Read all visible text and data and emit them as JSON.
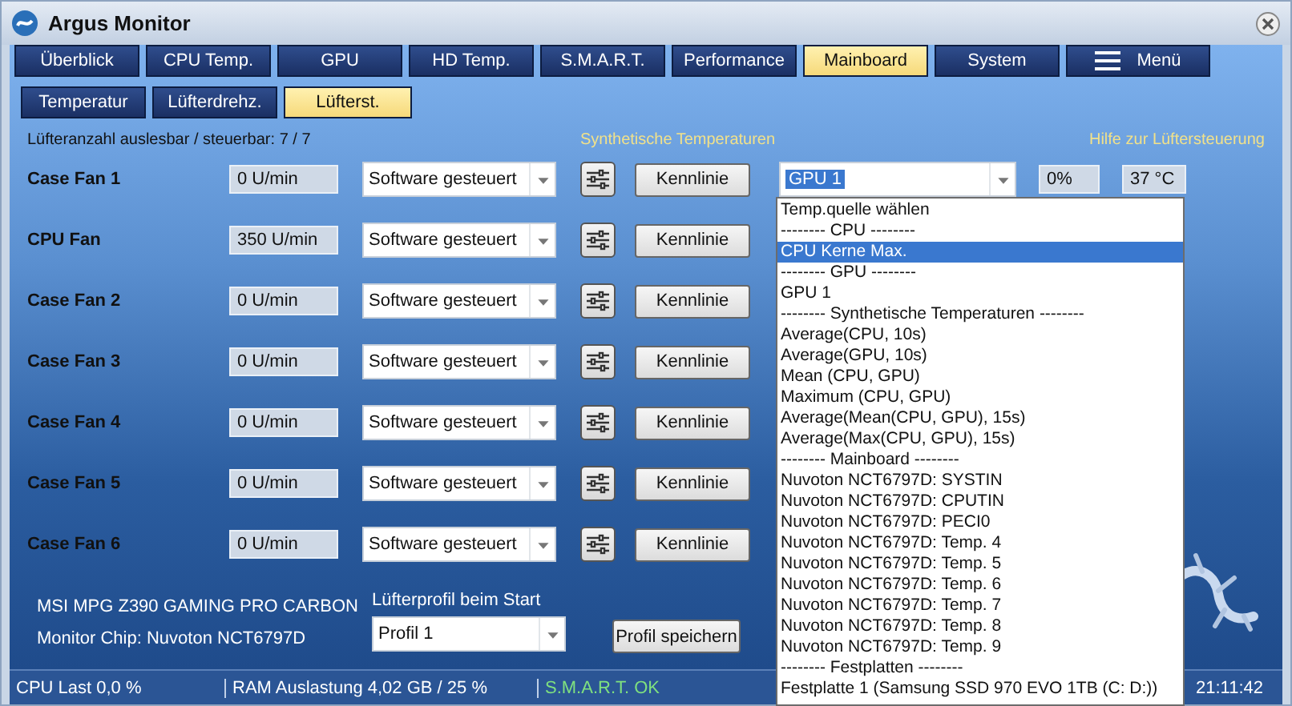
{
  "window": {
    "title": "Argus Monitor"
  },
  "tabs": [
    {
      "label": "Überblick",
      "selected": false,
      "kind": "plain"
    },
    {
      "label": "CPU Temp.",
      "selected": false,
      "kind": "plain"
    },
    {
      "label": "GPU",
      "selected": false,
      "kind": "plain"
    },
    {
      "label": "HD Temp.",
      "selected": false,
      "kind": "plain"
    },
    {
      "label": "S.M.A.R.T.",
      "selected": false,
      "kind": "plain"
    },
    {
      "label": "Performance",
      "selected": false,
      "kind": "plain"
    },
    {
      "label": "Mainboard",
      "selected": true,
      "kind": "plain"
    },
    {
      "label": "System",
      "selected": false,
      "kind": "plain"
    },
    {
      "label": "Menü",
      "selected": false,
      "kind": "menu"
    }
  ],
  "subtabs": [
    {
      "label": "Temperatur",
      "selected": false
    },
    {
      "label": "Lüfterdrehz.",
      "selected": false
    },
    {
      "label": "Lüfterst.",
      "selected": true
    }
  ],
  "info": {
    "fan_count": "Lüfteranzahl auslesbar / steuerbar: 7 / 7",
    "synthetic_link": "Synthetische Temperaturen",
    "help_link": "Hilfe zur Lüftersteuerung"
  },
  "fans": [
    {
      "name": "Case Fan 1",
      "speed": "0 U/min",
      "mode": "Software gesteuert",
      "button": "Kennlinie",
      "source": "GPU 1",
      "percent": "0%",
      "temp": "37 °C"
    },
    {
      "name": "CPU Fan",
      "speed": "350 U/min",
      "mode": "Software gesteuert",
      "button": "Kennlinie"
    },
    {
      "name": "Case Fan 2",
      "speed": "0 U/min",
      "mode": "Software gesteuert",
      "button": "Kennlinie"
    },
    {
      "name": "Case Fan 3",
      "speed": "0 U/min",
      "mode": "Software gesteuert",
      "button": "Kennlinie"
    },
    {
      "name": "Case Fan 4",
      "speed": "0 U/min",
      "mode": "Software gesteuert",
      "button": "Kennlinie"
    },
    {
      "name": "Case Fan 5",
      "speed": "0 U/min",
      "mode": "Software gesteuert",
      "button": "Kennlinie"
    },
    {
      "name": "Case Fan 6",
      "speed": "0 U/min",
      "mode": "Software gesteuert",
      "button": "Kennlinie"
    }
  ],
  "dropdown": [
    {
      "label": "Temp.quelle wählen",
      "selected": false
    },
    {
      "label": "-------- CPU --------",
      "selected": false
    },
    {
      "label": "CPU Kerne Max.",
      "selected": true
    },
    {
      "label": "-------- GPU --------",
      "selected": false
    },
    {
      "label": "GPU 1",
      "selected": false
    },
    {
      "label": "-------- Synthetische Temperaturen --------",
      "selected": false
    },
    {
      "label": "Average(CPU, 10s)",
      "selected": false
    },
    {
      "label": "Average(GPU, 10s)",
      "selected": false
    },
    {
      "label": "Mean (CPU, GPU)",
      "selected": false
    },
    {
      "label": "Maximum (CPU, GPU)",
      "selected": false
    },
    {
      "label": "Average(Mean(CPU, GPU), 15s)",
      "selected": false
    },
    {
      "label": "Average(Max(CPU, GPU), 15s)",
      "selected": false
    },
    {
      "label": "-------- Mainboard --------",
      "selected": false
    },
    {
      "label": "Nuvoton NCT6797D: SYSTIN",
      "selected": false
    },
    {
      "label": "Nuvoton NCT6797D: CPUTIN",
      "selected": false
    },
    {
      "label": "Nuvoton NCT6797D: PECI0",
      "selected": false
    },
    {
      "label": "Nuvoton NCT6797D: Temp. 4",
      "selected": false
    },
    {
      "label": "Nuvoton NCT6797D: Temp. 5",
      "selected": false
    },
    {
      "label": "Nuvoton NCT6797D: Temp. 6",
      "selected": false
    },
    {
      "label": "Nuvoton NCT6797D: Temp. 7",
      "selected": false
    },
    {
      "label": "Nuvoton NCT6797D: Temp. 8",
      "selected": false
    },
    {
      "label": "Nuvoton NCT6797D: Temp. 9",
      "selected": false
    },
    {
      "label": "-------- Festplatten --------",
      "selected": false
    },
    {
      "label": "Festplatte 1 (Samsung SSD 970 EVO 1TB (C: D:))",
      "selected": false
    }
  ],
  "board": {
    "model": "MSI MPG Z390 GAMING PRO CARBON",
    "chip": "Monitor Chip: Nuvoton NCT6797D",
    "profile_label": "Lüfterprofil beim Start",
    "profile_value": "Profil 1",
    "save_button": "Profil speichern"
  },
  "status": {
    "cpu": "CPU Last 0,0 %",
    "ram": "RAM Auslastung 4,02 GB / 25 %",
    "smart": "S.M.A.R.T. OK",
    "time": "21:11:42"
  }
}
